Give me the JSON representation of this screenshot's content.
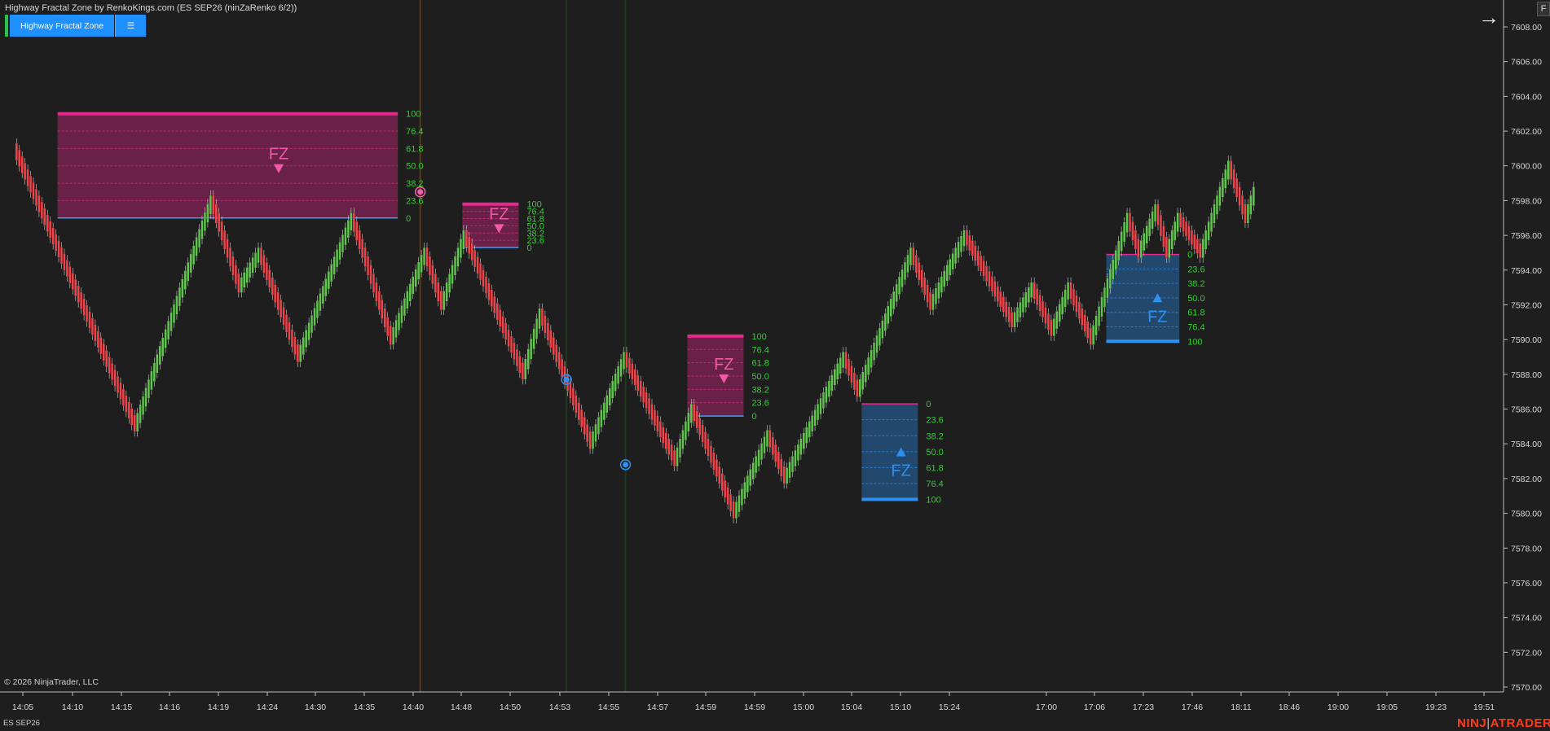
{
  "header": {
    "title": "Highway Fractal Zone by RenkoKings.com (ES SEP26 (ninZaRenko 6/2))",
    "indicator_button": "Highway Fractal Zone",
    "menu_button": "☰",
    "right_arrow": "→",
    "f_button": "F"
  },
  "footer": {
    "copyright": "© 2026 NinjaTrader, LLC",
    "instrument": "ES SEP26",
    "logo_left": "NINJ",
    "logo_sep": "|",
    "logo_right": "ATRADER"
  },
  "colors": {
    "background": "#1e1e1e",
    "up_brick": "#5fc84a",
    "down_brick": "#f0444a",
    "bear_zone": "#e6288c",
    "bull_zone": "#2d8ff0",
    "zero_line": "#3a9cff",
    "level_text": "#2fd02f"
  },
  "chart_data": {
    "type": "renko",
    "y_axis": {
      "min": 7570.0,
      "max": 7608.0,
      "ticks": [
        "7608.00",
        "7606.00",
        "7604.00",
        "7602.00",
        "7600.00",
        "7598.00",
        "7596.00",
        "7594.00",
        "7592.00",
        "7590.00",
        "7588.00",
        "7586.00",
        "7584.00",
        "7582.00",
        "7580.00",
        "7578.00",
        "7576.00",
        "7574.00",
        "7572.00",
        "7570.00"
      ]
    },
    "x_axis": {
      "ticks": [
        "14:05",
        "14:10",
        "14:15",
        "14:16",
        "14:19",
        "14:24",
        "14:30",
        "14:35",
        "14:40",
        "14:48",
        "14:50",
        "14:53",
        "14:55",
        "14:57",
        "14:59",
        "14:59",
        "15:00",
        "15:04",
        "15:10",
        "15:24",
        "17:00",
        "17:06",
        "17:23",
        "17:46",
        "18:11",
        "18:46",
        "19:00",
        "19:05",
        "19:23",
        "19:51"
      ]
    },
    "path": [
      {
        "bar": 2,
        "price": 7601.0
      },
      {
        "bar": 10,
        "price": 7598.0
      },
      {
        "bar": 45,
        "price": 7585.0
      },
      {
        "bar": 72,
        "price": 7598.0
      },
      {
        "bar": 82,
        "price": 7593.0
      },
      {
        "bar": 89,
        "price": 7595.0
      },
      {
        "bar": 103,
        "price": 7589.0
      },
      {
        "bar": 122,
        "price": 7597.0
      },
      {
        "bar": 136,
        "price": 7590.0
      },
      {
        "bar": 148,
        "price": 7595.0
      },
      {
        "bar": 154,
        "price": 7592.0
      },
      {
        "bar": 162,
        "price": 7596.0
      },
      {
        "bar": 183,
        "price": 7588.0
      },
      {
        "bar": 189,
        "price": 7591.5
      },
      {
        "bar": 207,
        "price": 7584.0
      },
      {
        "bar": 219,
        "price": 7589.0
      },
      {
        "bar": 237,
        "price": 7583.0
      },
      {
        "bar": 243,
        "price": 7586.0
      },
      {
        "bar": 258,
        "price": 7580.0
      },
      {
        "bar": 270,
        "price": 7584.5
      },
      {
        "bar": 276,
        "price": 7582.0
      },
      {
        "bar": 297,
        "price": 7589.0
      },
      {
        "bar": 302,
        "price": 7587.0
      },
      {
        "bar": 321,
        "price": 7595.0
      },
      {
        "bar": 328,
        "price": 7592.0
      },
      {
        "bar": 340,
        "price": 7596.0
      },
      {
        "bar": 357,
        "price": 7591.0
      },
      {
        "bar": 364,
        "price": 7593.0
      },
      {
        "bar": 371,
        "price": 7590.5
      },
      {
        "bar": 377,
        "price": 7593.0
      },
      {
        "bar": 385,
        "price": 7590.0
      },
      {
        "bar": 398,
        "price": 7597.0
      },
      {
        "bar": 402,
        "price": 7595.0
      },
      {
        "bar": 408,
        "price": 7597.5
      },
      {
        "bar": 412,
        "price": 7595.0
      },
      {
        "bar": 416,
        "price": 7597.0
      },
      {
        "bar": 424,
        "price": 7595.0
      },
      {
        "bar": 434,
        "price": 7600.0
      },
      {
        "bar": 440,
        "price": 7597.0
      },
      {
        "bar": 443,
        "price": 7598.5
      }
    ],
    "zones": [
      {
        "direction": "bearish",
        "label": "FZ",
        "from_bar": 17,
        "to_bar": 138,
        "top": 7603.0,
        "base": 7597.0,
        "levels": [
          "100",
          "76.4",
          "61.8",
          "50.0",
          "38.2",
          "23.6",
          "0"
        ]
      },
      {
        "direction": "bearish",
        "label": "FZ",
        "from_bar": 161,
        "to_bar": 181,
        "top": 7597.8,
        "base": 7595.3,
        "levels": [
          "100",
          "76.4",
          "61.8",
          "50.0",
          "38.2",
          "23.6",
          "0"
        ]
      },
      {
        "direction": "bearish",
        "label": "FZ",
        "from_bar": 241,
        "to_bar": 261,
        "top": 7590.2,
        "base": 7585.6,
        "levels": [
          "100",
          "76.4",
          "61.8",
          "50.0",
          "38.2",
          "23.6",
          "0"
        ]
      },
      {
        "direction": "bullish",
        "label": "FZ",
        "from_bar": 303,
        "to_bar": 323,
        "top": 7586.3,
        "base": 7580.8,
        "levels": [
          "0",
          "23.6",
          "38.2",
          "50.0",
          "61.8",
          "76.4",
          "100"
        ]
      },
      {
        "direction": "bullish",
        "label": "FZ",
        "from_bar": 390,
        "to_bar": 416,
        "top": 7594.9,
        "base": 7589.9,
        "levels": [
          "0",
          "23.6",
          "38.2",
          "50.0",
          "61.8",
          "76.4",
          "100"
        ]
      }
    ],
    "markers": [
      {
        "type": "circle",
        "color": "pink",
        "bar": 146,
        "price": 7598.5
      },
      {
        "type": "circle",
        "color": "blue",
        "bar": 198,
        "price": 7587.7
      },
      {
        "type": "circle",
        "color": "blue",
        "bar": 219,
        "price": 7582.8
      }
    ],
    "vertical_lines": [
      {
        "bar": 146,
        "color": "#5a3a1a"
      },
      {
        "bar": 198,
        "color": "#1f3a1f"
      },
      {
        "bar": 219,
        "color": "#1f3a1f"
      }
    ]
  }
}
